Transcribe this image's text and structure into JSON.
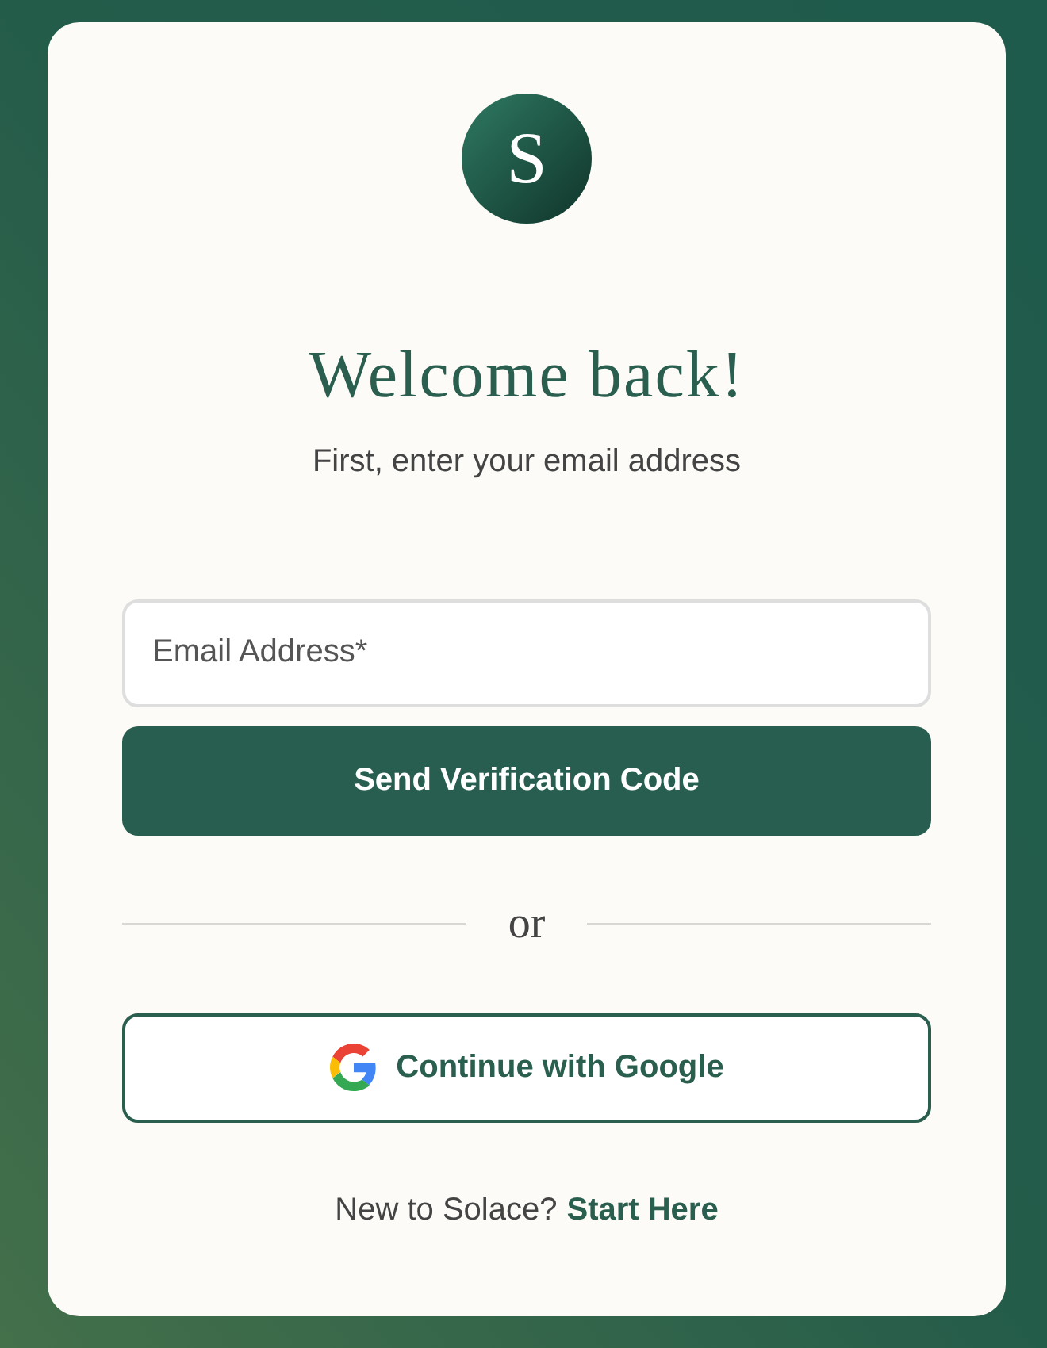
{
  "logo": {
    "letter": "S"
  },
  "heading": "Welcome back!",
  "subheading": "First, enter your email address",
  "email_field": {
    "placeholder": "Email Address*"
  },
  "primary_button": "Send Verification Code",
  "divider": "or",
  "google_button": "Continue with Google",
  "footer": {
    "text": "New to Solace?",
    "link": "Start Here"
  }
}
